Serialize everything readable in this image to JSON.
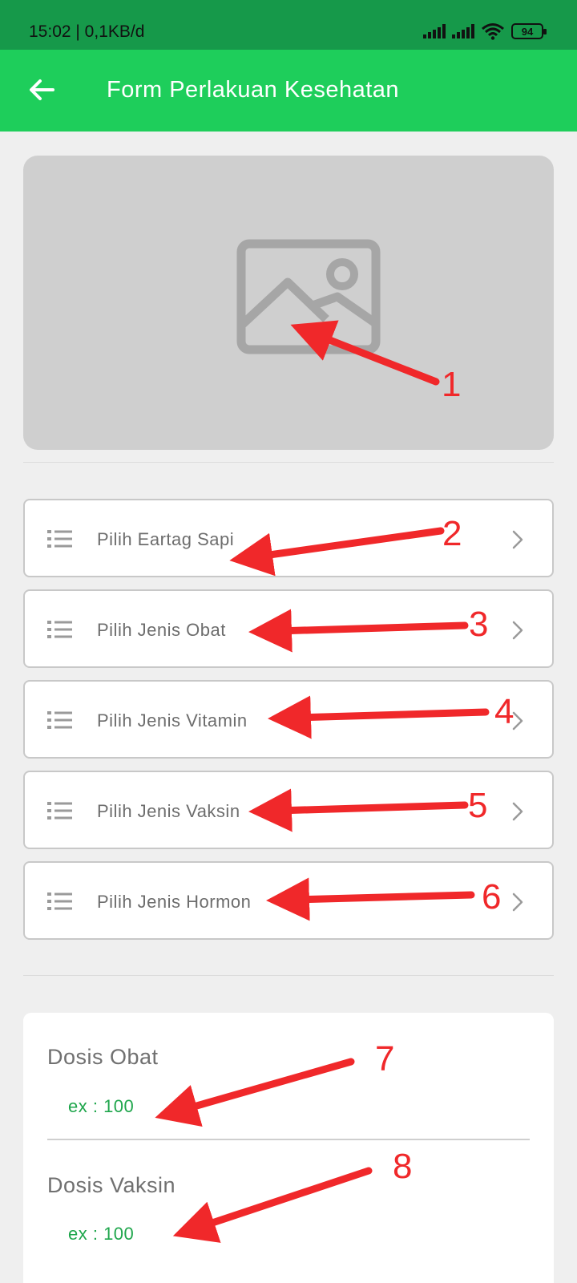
{
  "status_bar": {
    "time": "15:02 | 0,1KB/d",
    "battery": "94"
  },
  "app_bar": {
    "back_icon": "arrow-left-icon",
    "title": "Form Perlakuan Kesehatan"
  },
  "image_picker": {
    "icon": "image-placeholder-icon"
  },
  "selectors": [
    {
      "label": "Pilih Eartag Sapi"
    },
    {
      "label": "Pilih Jenis Obat"
    },
    {
      "label": "Pilih Jenis Vitamin"
    },
    {
      "label": "Pilih Jenis Vaksin"
    },
    {
      "label": "Pilih Jenis Hormon"
    }
  ],
  "dosage": {
    "obat_label": "Dosis Obat",
    "obat_placeholder": "ex : 100",
    "vaksin_label": "Dosis Vaksin",
    "vaksin_placeholder": "ex : 100"
  },
  "annotations": [
    "1",
    "2",
    "3",
    "4",
    "5",
    "6",
    "7",
    "8"
  ],
  "colors": {
    "status_bar": "#16994a",
    "app_bar": "#1ece5b",
    "accent_text": "#1fa64c",
    "annotation": "#f0282a"
  }
}
